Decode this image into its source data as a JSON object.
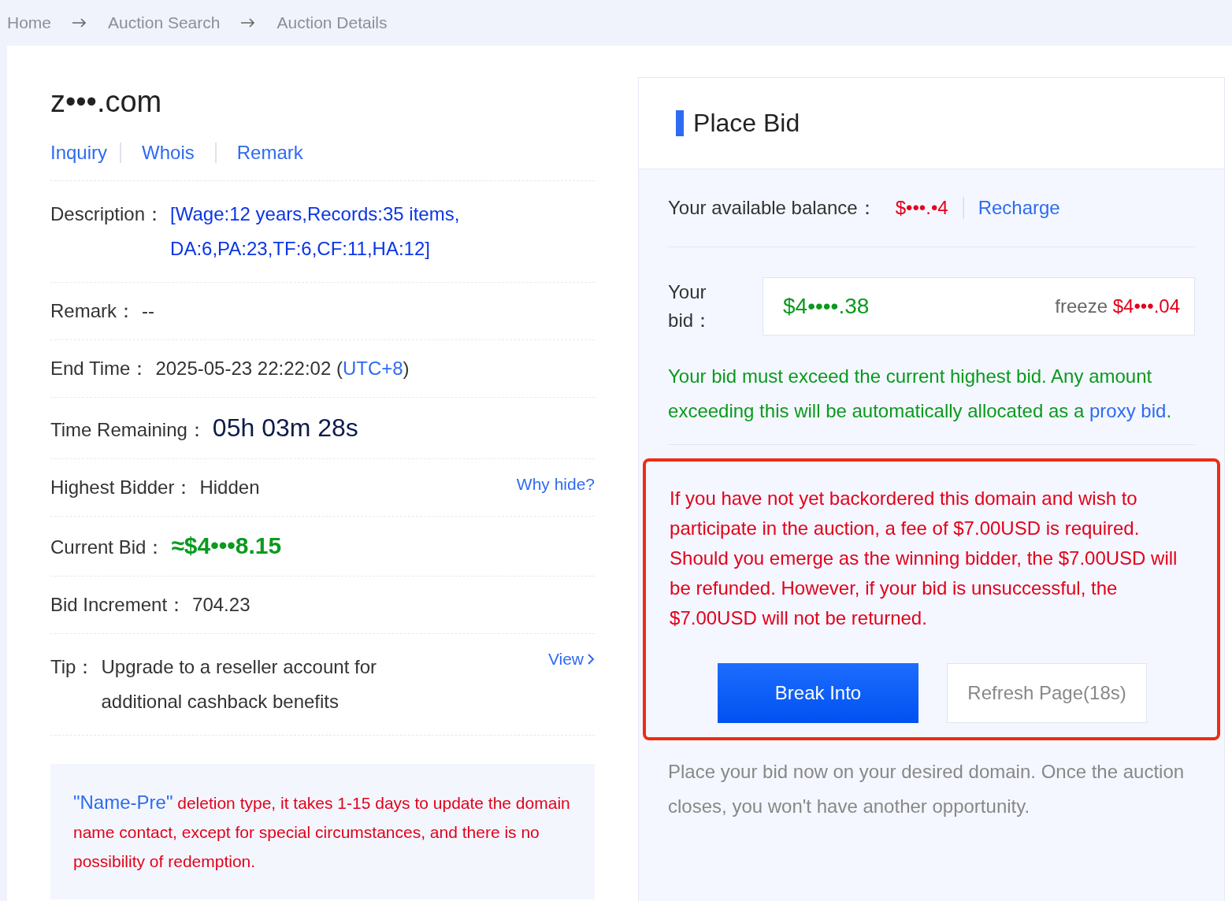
{
  "breadcrumb": [
    "Home",
    "Auction Search",
    "Auction Details"
  ],
  "domain": "z•••.com",
  "links": [
    "Inquiry",
    "Whois",
    "Remark"
  ],
  "details": [
    {
      "kind": "description",
      "label": "Description：",
      "value": "[Wage:12 years,Records:35 items, DA:6,PA:23,TF:6,CF:11,HA:12]"
    },
    {
      "kind": "plain",
      "label": "Remark：",
      "value": "--"
    },
    {
      "kind": "time",
      "label": "End Time：",
      "value": "2025-05-23 22:22:02 (",
      "zone": "UTC+8",
      "tail": ")"
    },
    {
      "kind": "countdown",
      "label": "Time Remaining：",
      "value": "05h 03m 28s"
    },
    {
      "kind": "plain",
      "label": "Highest Bidder：",
      "value": "Hidden",
      "link": "Why hide?"
    },
    {
      "kind": "price",
      "label": "Current Bid：",
      "value": "≈$4•••8.15"
    },
    {
      "kind": "plain",
      "label": "Bid Increment：",
      "value": "704.23"
    },
    {
      "kind": "tip",
      "label": "Tip：",
      "value": "Upgrade to a reseller account for additional cashback benefits",
      "link": "View"
    }
  ],
  "notice": {
    "highlight": "\"Name-Pre\"",
    "text": " deletion type, it takes 1-15 days to update the domain name contact, except for special circumstances, and there is no possibility of redemption."
  },
  "bid_panel": {
    "title": "Place Bid",
    "balance_label": "Your available balance：",
    "balance": "$•••.•4",
    "recharge": "Recharge",
    "bid_label": "Your bid：",
    "bid_value": "$4••••.38",
    "freeze_label": "freeze",
    "freeze_value": "$4•••.04",
    "rule": "Your bid must exceed the current highest bid. Any amount exceeding this will be automatically allocated as a ",
    "rule_link": "proxy bid",
    "rule_end": ".",
    "warning": [
      "If you have not yet backordered this domain and wish to participate in the auction, a fee of $7.00USD is required.",
      "Should you emerge as the winning bidder, the $7.00USD will be refunded. However, if your bid is unsuccessful, the $7.00USD will not be returned."
    ],
    "primary_button": "Break Into",
    "secondary_button": "Refresh Page(18s)",
    "footer": "Place your bid now on your desired domain. Once the auction closes, you won't have another opportunity."
  }
}
